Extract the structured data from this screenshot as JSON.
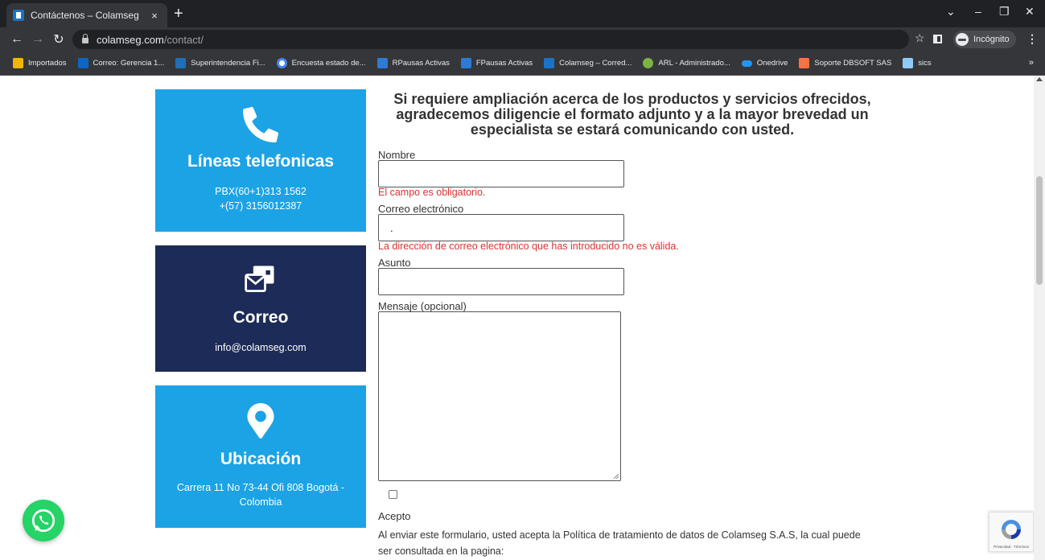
{
  "browser": {
    "tab_title": "Contáctenos – Colamseg",
    "tab_close": "×",
    "new_tab": "+",
    "url_host": "colamseg.com",
    "url_path": "/contact/",
    "incognito_label": "Incógnito",
    "bookmarks": [
      {
        "label": "Importados",
        "color": "#f2b600"
      },
      {
        "label": "Correo: Gerencia 1...",
        "color": "#0a66c2"
      },
      {
        "label": "Superintendencia Fi...",
        "color": "#1d6fb8"
      },
      {
        "label": "Encuesta estado de...",
        "color": "#ffffff"
      },
      {
        "label": "RPausas Activas",
        "color": "#2d7bd6"
      },
      {
        "label": "FPausas Activas",
        "color": "#2d7bd6"
      },
      {
        "label": "Colamseg – Corred...",
        "color": "#1a73c8"
      },
      {
        "label": "ARL - Administrado...",
        "color": "#7cb342"
      },
      {
        "label": "Onedrive",
        "color": "#2196f3"
      },
      {
        "label": "Soporte DBSOFT SAS",
        "color": "#ff7043"
      },
      {
        "label": "sics",
        "color": "#90caf9"
      }
    ],
    "bookmarks_more": "»"
  },
  "contact_cards": {
    "phone": {
      "title": "Líneas telefonicas",
      "line1": "PBX(60+1)313 1562",
      "line2": "+(57) 3156012387"
    },
    "mail": {
      "title": "Correo",
      "line1": "info@colamseg.com"
    },
    "location": {
      "title": "Ubicación",
      "line1": "Carrera 11 No 73-44 Ofi 808 Bogotá - Colombia"
    }
  },
  "form": {
    "heading": "Si requiere ampliación acerca de los productos y servicios ofrecidos, agradecemos diligencie el formato adjunto y a la mayor brevedad un especialista se estará comunicando con usted.",
    "name_label": "Nombre",
    "name_value": "",
    "name_error": "El campo es obligatorio.",
    "email_label": "Correo electrónico",
    "email_value": ".",
    "email_error": "La dirección de correo electrónico que has introducido no es válida.",
    "subject_label": "Asunto",
    "subject_value": "",
    "message_label": "Mensaje (opcional)",
    "accept_label": "Acepto",
    "policy_text": "Al enviar este formulario, usted acepta la Política de tratamiento de datos de Colamseg S.A.S, la cual puede ser consultada en la pagina:"
  },
  "recaptcha": {
    "links": "Privacidad - Términos"
  },
  "colors": {
    "card_blue": "#1ba3e5",
    "card_navy": "#1c2b57",
    "error_red": "#dc3232",
    "whatsapp_green": "#25d366"
  }
}
